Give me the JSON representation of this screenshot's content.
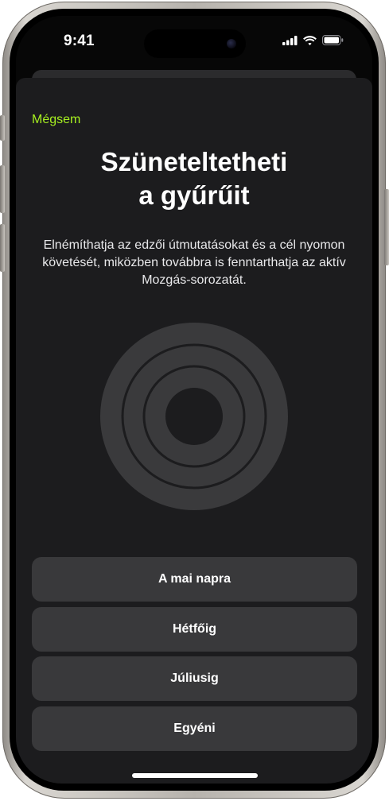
{
  "status_bar": {
    "time": "9:41",
    "icons": [
      "cellular-signal-icon",
      "wifi-icon",
      "battery-icon"
    ]
  },
  "sheet": {
    "cancel_label": "Mégsem",
    "title": "Szüneteltetheti\na gyűrűit",
    "description": "Elnémíthatja az edzői útmutatásokat és a cél nyomon követését, miközben továbbra is fenntarthatja az aktív Mozgás-sorozatát.",
    "illustration": "activity-rings-icon",
    "options": [
      {
        "label": "A mai napra"
      },
      {
        "label": "Hétfőig"
      },
      {
        "label": "Júliusig"
      },
      {
        "label": "Egyéni"
      }
    ]
  },
  "colors": {
    "accent": "#a7f020",
    "sheet_background": "#1c1c1e",
    "button_background": "#39393b",
    "ring_color": "#3a3a3c"
  }
}
